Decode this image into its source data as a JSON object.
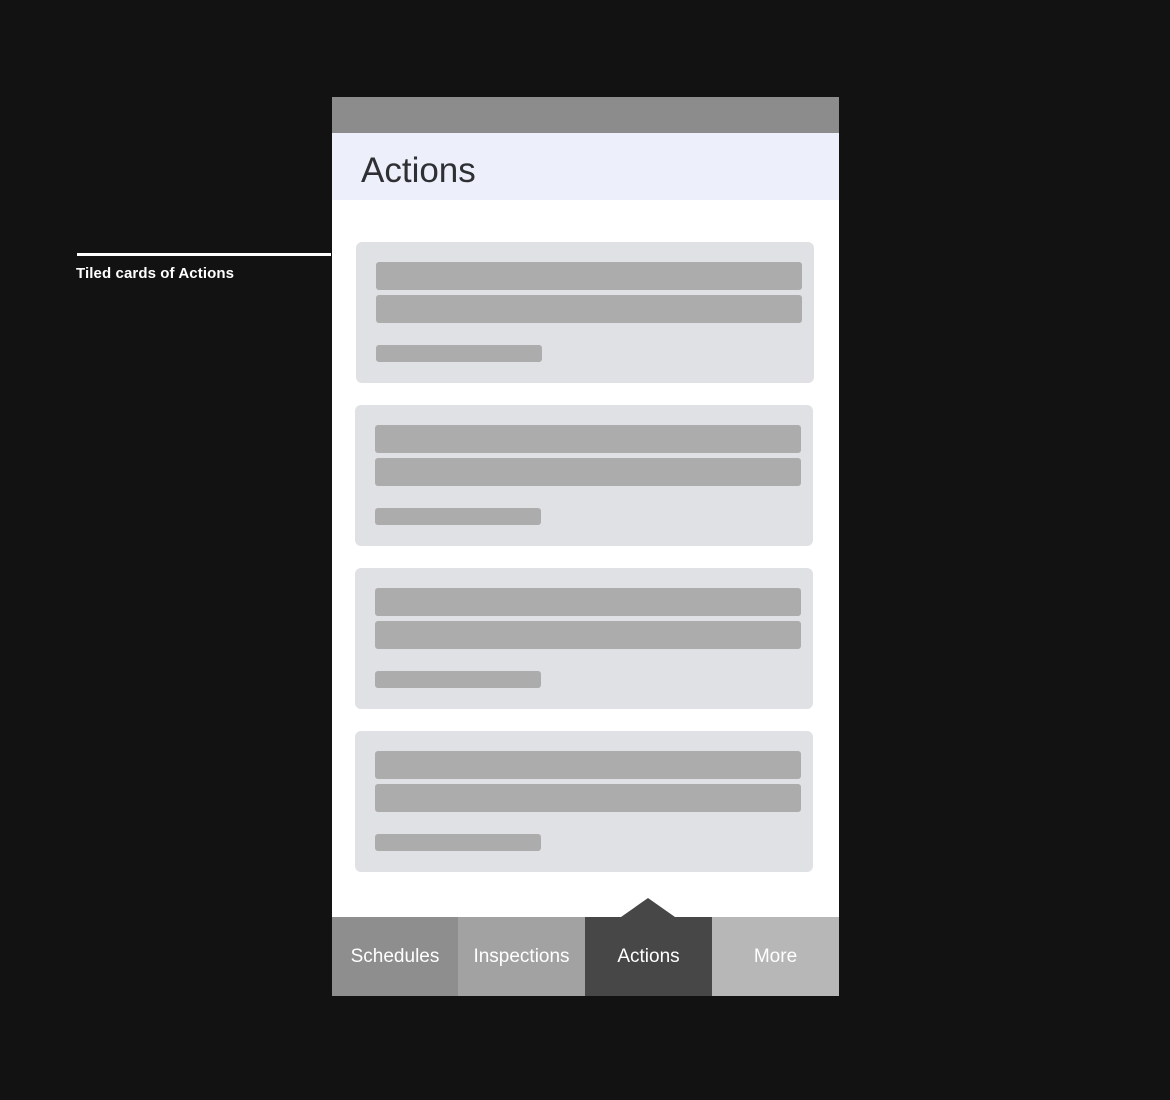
{
  "annotation": {
    "label": "Tiled cards of Actions"
  },
  "header": {
    "title": "Actions"
  },
  "cards": [
    {
      "kind": "placeholder-card"
    },
    {
      "kind": "placeholder-card"
    },
    {
      "kind": "placeholder-card"
    },
    {
      "kind": "placeholder-card"
    }
  ],
  "bottom_nav": {
    "tabs": [
      {
        "label": "Schedules",
        "active": false
      },
      {
        "label": "Inspections",
        "active": false
      },
      {
        "label": "Actions",
        "active": true
      },
      {
        "label": "More",
        "active": false
      }
    ]
  },
  "colors": {
    "background": "#121212",
    "header_bg": "#edeffa",
    "status_bar": "#8c8c8c",
    "card_bg": "#dfe1e4",
    "placeholder_bar": "#acacac",
    "active_tab": "#474747"
  }
}
